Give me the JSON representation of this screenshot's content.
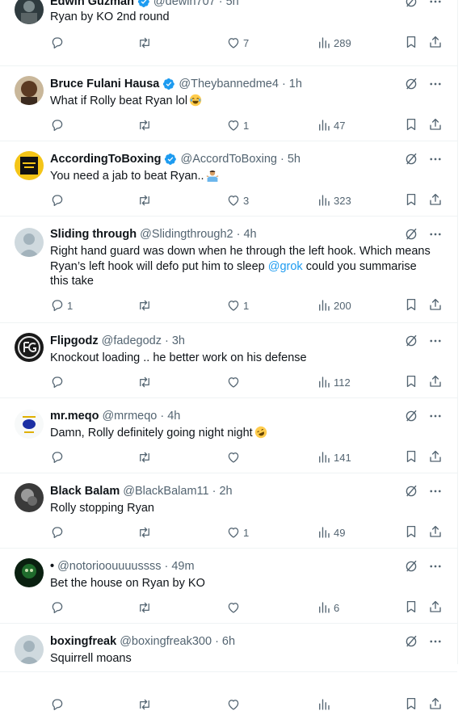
{
  "colors": {
    "text": "#0f1419",
    "secondary": "#536471",
    "verified": "#1d9bf0",
    "link": "#1d9bf0",
    "divider": "#eff3f4"
  },
  "icons": [
    "verified-badge-icon",
    "grok-icon",
    "more-icon",
    "reply-icon",
    "retweet-icon",
    "like-icon",
    "views-icon",
    "bookmark-icon",
    "share-icon"
  ],
  "tweets": [
    {
      "name": "Edwin Guzman",
      "verified": true,
      "handle": "@dewin707",
      "time": "5h",
      "text": "Ryan by KO 2nd round",
      "replies": "",
      "retweets": "",
      "likes": "7",
      "views": "289"
    },
    {
      "name": "Bruce Fulani Hausa",
      "verified": true,
      "handle": "@Theybannedme4",
      "time": "1h",
      "text": "What if Rolly beat Ryan lol",
      "emoji": "joy",
      "replies": "",
      "retweets": "",
      "likes": "1",
      "views": "47"
    },
    {
      "name": "AccordingToBoxing",
      "verified": true,
      "handle": "@AccordToBoxing",
      "time": "5h",
      "text": "You need a jab to beat Ryan..",
      "emoji": "shrug",
      "replies": "",
      "retweets": "",
      "likes": "3",
      "views": "323"
    },
    {
      "name": "Sliding through",
      "verified": false,
      "handle": "@Slidingthrough2",
      "time": "4h",
      "text": "Right hand guard was down when he through the left hook. Which means Ryan’s left hook will defo put him to sleep ",
      "mention": "@grok",
      "text_after": " could you summarise this take",
      "replies": "1",
      "retweets": "",
      "likes": "1",
      "views": "200"
    },
    {
      "name": "Flipgodz",
      "verified": false,
      "handle": "@fadegodz",
      "time": "3h",
      "text": "Knockout loading .. he better work on his defense",
      "replies": "",
      "retweets": "",
      "likes": "",
      "views": "112"
    },
    {
      "name": "mr.meqo",
      "verified": false,
      "handle": "@mrmeqo",
      "time": "4h",
      "text": "Damn, Rolly definitely going night night",
      "emoji": "rofl",
      "replies": "",
      "retweets": "",
      "likes": "",
      "views": "141"
    },
    {
      "name": "Black Balam",
      "verified": false,
      "handle": "@BlackBalam11",
      "time": "2h",
      "text": "Rolly stopping Ryan",
      "replies": "",
      "retweets": "",
      "likes": "1",
      "views": "49"
    },
    {
      "name": "•",
      "verified": false,
      "handle": "@notorioouuuussss",
      "time": "49m",
      "text": "Bet the house on Ryan by KO",
      "replies": "",
      "retweets": "",
      "likes": "",
      "views": "6"
    },
    {
      "name": "boxingfreak",
      "verified": false,
      "handle": "@boxingfreak300",
      "time": "6h",
      "text": "Squirrell moans",
      "replies": "",
      "retweets": "",
      "likes": "",
      "views": ""
    }
  ]
}
